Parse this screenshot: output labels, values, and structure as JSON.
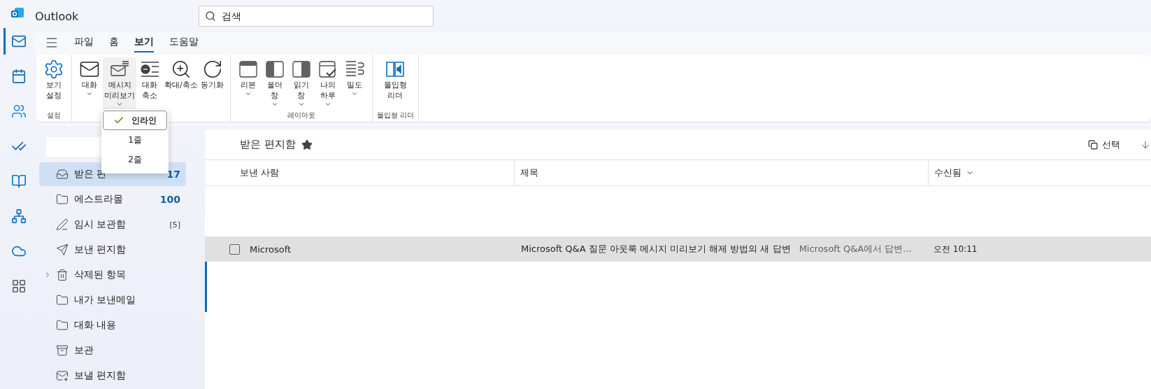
{
  "app": {
    "title": "Outlook"
  },
  "search": {
    "placeholder": "검색"
  },
  "rail": [
    {
      "kind": "mail",
      "selected": true
    },
    {
      "kind": "calendar",
      "selected": false
    },
    {
      "kind": "people",
      "selected": false
    },
    {
      "kind": "todo",
      "selected": false
    },
    {
      "kind": "book",
      "selected": false
    },
    {
      "kind": "org",
      "selected": false
    },
    {
      "kind": "cloud",
      "selected": false
    },
    {
      "kind": "apps",
      "selected": false
    }
  ],
  "menu_tabs": [
    {
      "label": "파일",
      "selected": false
    },
    {
      "label": "홈",
      "selected": false
    },
    {
      "label": "보기",
      "selected": true
    },
    {
      "label": "도움말",
      "selected": false
    }
  ],
  "ribbon_groups": [
    {
      "label": "설정",
      "buttons": [
        {
          "kind": "gear",
          "label": "보기\n설정",
          "caret": false,
          "pressed": false
        }
      ]
    },
    {
      "buttons": [
        {
          "kind": "mail",
          "label": "대화",
          "caret": true,
          "pressed": false
        },
        {
          "kind": "preview",
          "label": "메시지\n미리보기",
          "caret": true,
          "pressed": true
        },
        {
          "kind": "collapse",
          "label": "대화\n축소",
          "caret": false,
          "pressed": false
        },
        {
          "kind": "zoom",
          "label": "확대/축소",
          "caret": false,
          "pressed": false
        },
        {
          "kind": "sync",
          "label": "동기화",
          "caret": false,
          "pressed": false
        }
      ]
    },
    {
      "label": "레이아웃",
      "buttons": [
        {
          "kind": "ribbon",
          "label": "리본",
          "caret": true,
          "pressed": false
        },
        {
          "kind": "folderpane",
          "label": "폴더\n창",
          "caret": true,
          "pressed": false
        },
        {
          "kind": "readingpane",
          "label": "읽기\n창",
          "caret": true,
          "pressed": false
        },
        {
          "kind": "myday",
          "label": "나의\n하루",
          "caret": true,
          "pressed": false
        },
        {
          "kind": "density",
          "label": "밀도",
          "caret": true,
          "pressed": false
        }
      ]
    },
    {
      "label": "몰입형 리더",
      "buttons": [
        {
          "kind": "reader",
          "label": "몰입형\n리더",
          "caret": false,
          "pressed": false
        }
      ]
    }
  ],
  "preview_menu": [
    {
      "label": "인라인",
      "selected": true
    },
    {
      "label": "1줄",
      "selected": false
    },
    {
      "label": "2줄",
      "selected": false
    }
  ],
  "folders": [
    {
      "kind": "inbox",
      "name": "받은 편",
      "count": "17",
      "selected": true,
      "expandable": false
    },
    {
      "kind": "folder",
      "name": "에스트라몰",
      "count": "100",
      "selected": false,
      "expandable": false
    },
    {
      "kind": "draft",
      "name": "임시 보관함",
      "count": "[5]",
      "selected": false,
      "expandable": false
    },
    {
      "kind": "send",
      "name": "보낸 편지함",
      "selected": false,
      "expandable": false
    },
    {
      "kind": "trash",
      "name": "삭제된 항목",
      "expandable": true,
      "selected": false
    },
    {
      "kind": "folder",
      "name": "내가 보낸메일",
      "selected": false,
      "expandable": false
    },
    {
      "kind": "folder",
      "name": "대화 내용",
      "selected": false,
      "expandable": false
    },
    {
      "kind": "archive",
      "name": "보관",
      "selected": false,
      "expandable": false
    },
    {
      "kind": "outbox",
      "name": "보낼 편지함",
      "selected": false,
      "expandable": false
    }
  ],
  "list": {
    "title": "받은 편지함",
    "favorite": true,
    "select_label": "선택",
    "columns": [
      "보낸 사람",
      "제목",
      "수신됨"
    ],
    "rows": [
      {
        "unread": false,
        "selected": false
      },
      {
        "unread": false,
        "selected": false
      },
      {
        "sender": "Microsoft",
        "subject": "Microsoft Q&A 질문 아웃룩 메시지 미리보기 해제 방법의 새 답변",
        "preview": "Microsoft Q&A에서 답변...",
        "time": "오전 10:11",
        "unread": false,
        "selected": true
      },
      {
        "unread": true,
        "selected": false
      },
      {
        "unread": true,
        "selected": false
      },
      {
        "unread": false,
        "selected": false
      },
      {
        "unread": false,
        "selected": false
      }
    ]
  }
}
